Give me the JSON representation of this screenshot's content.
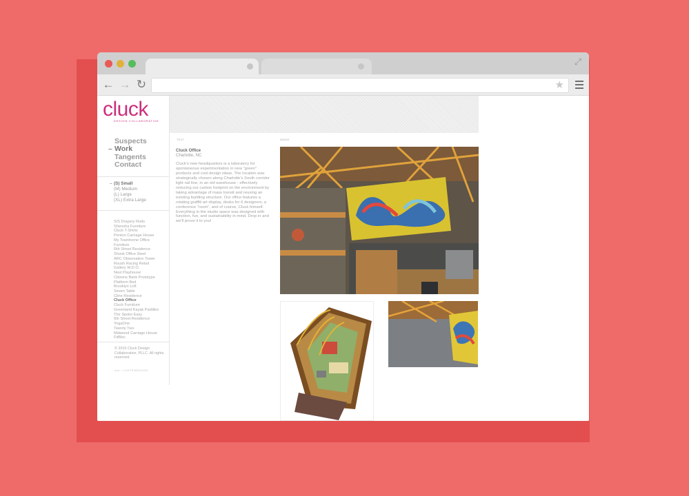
{
  "browser": {
    "url": "",
    "colors": {
      "background": "#ee6b6a",
      "shadow": "#e34e4f",
      "brand": "#cc2f7c"
    }
  },
  "logo": {
    "word": "cluck",
    "tagline": "DESIGN COLLABORATIVE"
  },
  "nav": {
    "items": [
      {
        "label": "Suspects",
        "active": false
      },
      {
        "label": "Work",
        "active": true
      },
      {
        "label": "Tangents",
        "active": false
      },
      {
        "label": "Contact",
        "active": false
      }
    ]
  },
  "sizes": {
    "items": [
      {
        "label": "(S) Small",
        "active": true
      },
      {
        "label": "(M) Medium",
        "active": false
      },
      {
        "label": "(L) Large",
        "active": false
      },
      {
        "label": "(XL) Extra Large",
        "active": false
      }
    ]
  },
  "projects": {
    "items": [
      {
        "label": "S/S Drapery Rods",
        "active": false
      },
      {
        "label": "Shenoha Furniture",
        "active": false
      },
      {
        "label": "Cluck T-Shirts",
        "active": false
      },
      {
        "label": "Penton Carriage House",
        "active": false
      },
      {
        "label": "My Townhome Office",
        "active": false
      },
      {
        "label": "Furniture",
        "active": false
      },
      {
        "label": "Rth Street Residence",
        "active": false
      },
      {
        "label": "Shook Office Steel",
        "active": false
      },
      {
        "label": "ARC Observation Tower",
        "active": false
      },
      {
        "label": "Roush Racing Retail",
        "active": false
      },
      {
        "label": "Gallery W.D.O.",
        "active": false
      },
      {
        "label": "Nest Playhouse",
        "active": false
      },
      {
        "label": "Citizens Bank Prototype",
        "active": false
      },
      {
        "label": "Platform Bed",
        "active": false
      },
      {
        "label": "Brooklyn Loft",
        "active": false
      },
      {
        "label": "Seven Table",
        "active": false
      },
      {
        "label": "Cline Residence",
        "active": false
      },
      {
        "label": "Cluck Office",
        "active": true
      },
      {
        "label": "Cluck Furniture",
        "active": false
      },
      {
        "label": "Greenland Kayak Paddles",
        "active": false
      },
      {
        "label": "The Spoke Easy",
        "active": false
      },
      {
        "label": "5th Street Residence",
        "active": false
      },
      {
        "label": "YogaOne",
        "active": false
      },
      {
        "label": "Twenty Two",
        "active": false
      },
      {
        "label": "Midwood Carriage House",
        "active": false
      },
      {
        "label": "FitBloc",
        "active": false
      }
    ]
  },
  "footer": {
    "copyright": "© 2015 Cluck Design Collaborative, PLLC. All rights reserved.",
    "credit": "site • LOSTENDESIGN"
  },
  "project": {
    "text_label": "TEXT",
    "image_label": "IMAGE",
    "title": "Cluck Office",
    "location": "Charlotte, NC",
    "description": "Cluck's new headquarters is a laboratory for spontaneous experimentation in new \"green\" products and cool design ideas. The location was strategically chosen along Charlotte's South corridor light rail line, in an old warehouse - effectively reducing our carbon footprint on the environment by taking advantage of mass transit and reusing an existing building structure. Our office features a rotating graffiti art display, desks for 6 designers, a conference \"room\", and of course, Cluck himself. Everything in the studio space was designed with function, fun, and sustainability in mind. Drop in and we'll prove it to you!"
  },
  "icons": {
    "back": "arrow-left-icon",
    "forward": "arrow-right-icon",
    "reload": "reload-icon",
    "bookmark": "star-icon",
    "menu": "hamburger-menu-icon",
    "expand": "expand-icon"
  }
}
